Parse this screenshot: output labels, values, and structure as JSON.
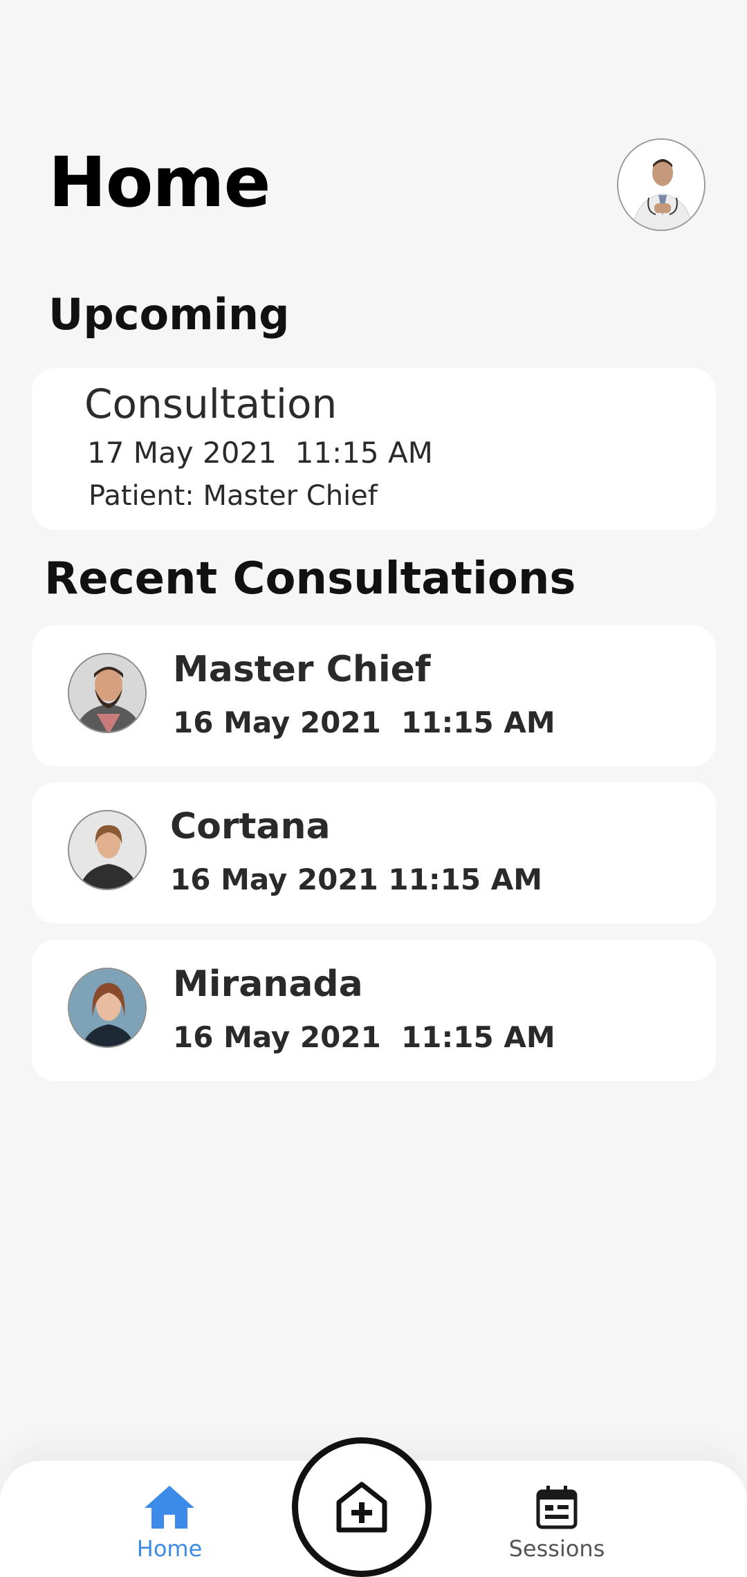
{
  "header": {
    "title": "Home"
  },
  "upcoming": {
    "section_title": "Upcoming",
    "card": {
      "title": "Consultation",
      "datetime": "17 May 2021  11:15 AM",
      "patient": "Patient: Master Chief"
    }
  },
  "recent": {
    "section_title": "Recent Consultations",
    "items": [
      {
        "name": "Master Chief",
        "datetime": "16 May 2021  11:15 AM"
      },
      {
        "name": "Cortana",
        "datetime": "16 May 2021  11:15 AM"
      },
      {
        "name": "Miranada",
        "datetime": "16 May 2021  11:15 AM"
      }
    ]
  },
  "bottom_nav": {
    "home_label": "Home",
    "sessions_label": "Sessions",
    "home_icon": "home-icon",
    "add_icon": "hospital-plus-icon",
    "sessions_icon": "calendar-icon",
    "active_color": "#3c8be8"
  }
}
